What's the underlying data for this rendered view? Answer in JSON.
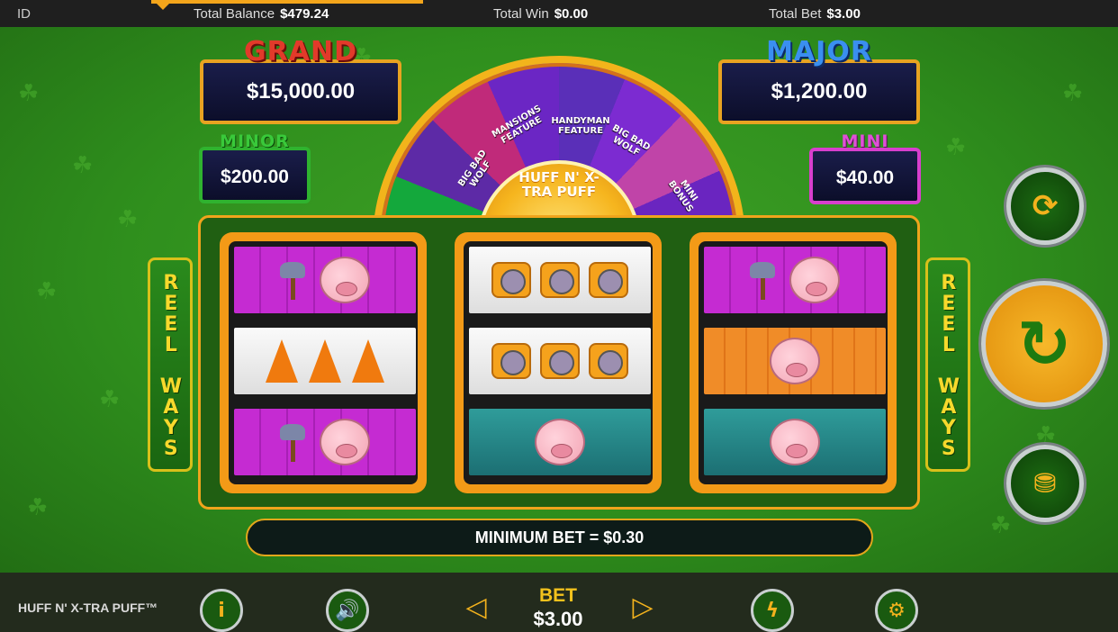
{
  "topbar": {
    "id_label": "ID",
    "balance_label": "Total Balance",
    "balance_value": "$479.24",
    "win_label": "Total Win",
    "win_value": "$0.00",
    "bet_label": "Total Bet",
    "bet_value": "$3.00"
  },
  "jackpots": {
    "grand": {
      "title": "GRAND",
      "value": "$15,000.00",
      "title_color": "#e23a2a"
    },
    "major": {
      "title": "MAJOR",
      "value": "$1,200.00",
      "title_color": "#3a8ff0"
    },
    "minor": {
      "title": "MINOR",
      "value": "$200.00",
      "title_color": "#39c93a"
    },
    "mini": {
      "title": "MINI",
      "value": "$40.00",
      "title_color": "#e04fd8"
    }
  },
  "wheel": {
    "hub_text": "HUFF N' X-TRA PUFF",
    "segments": [
      "BIG BAD WOLF",
      "MANSIONS FEATURE",
      "HANDYMAN FEATURE",
      "BIG BAD WOLF",
      "MINI BONUS"
    ]
  },
  "side_banners": {
    "left": "REEL WAYS",
    "right": "REEL WAYS"
  },
  "reels": [
    {
      "symbols": [
        {
          "type": "pig-axe",
          "bg": "purple"
        },
        {
          "type": "cones",
          "bg": "white"
        },
        {
          "type": "pig-axe",
          "bg": "purple"
        }
      ]
    },
    {
      "symbols": [
        {
          "type": "tape-measures",
          "bg": "white"
        },
        {
          "type": "tape-measures",
          "bg": "white"
        },
        {
          "type": "pig-wheat",
          "bg": "teal"
        }
      ]
    },
    {
      "symbols": [
        {
          "type": "pig-axe",
          "bg": "purple"
        },
        {
          "type": "pig-money",
          "bg": "orange"
        },
        {
          "type": "pig-wheat",
          "bg": "teal"
        }
      ]
    }
  ],
  "min_bet_text": "MINIMUM BET = $0.30",
  "bottombar": {
    "game_title": "HUFF N' X-TRA PUFF™",
    "bet_label": "BET",
    "bet_value": "$3.00"
  },
  "icons": {
    "info": "info-icon",
    "sound": "speaker-icon",
    "minus": "minus-icon",
    "plus": "plus-icon",
    "turbo": "turbo-icon",
    "settings": "gear-icon",
    "autoplay": "autoplay-icon",
    "spin": "spin-icon",
    "coins": "coins-icon"
  },
  "colors": {
    "accent": "#f3a51b",
    "field": "#2f8a1c",
    "gold": "#f3b21d"
  }
}
